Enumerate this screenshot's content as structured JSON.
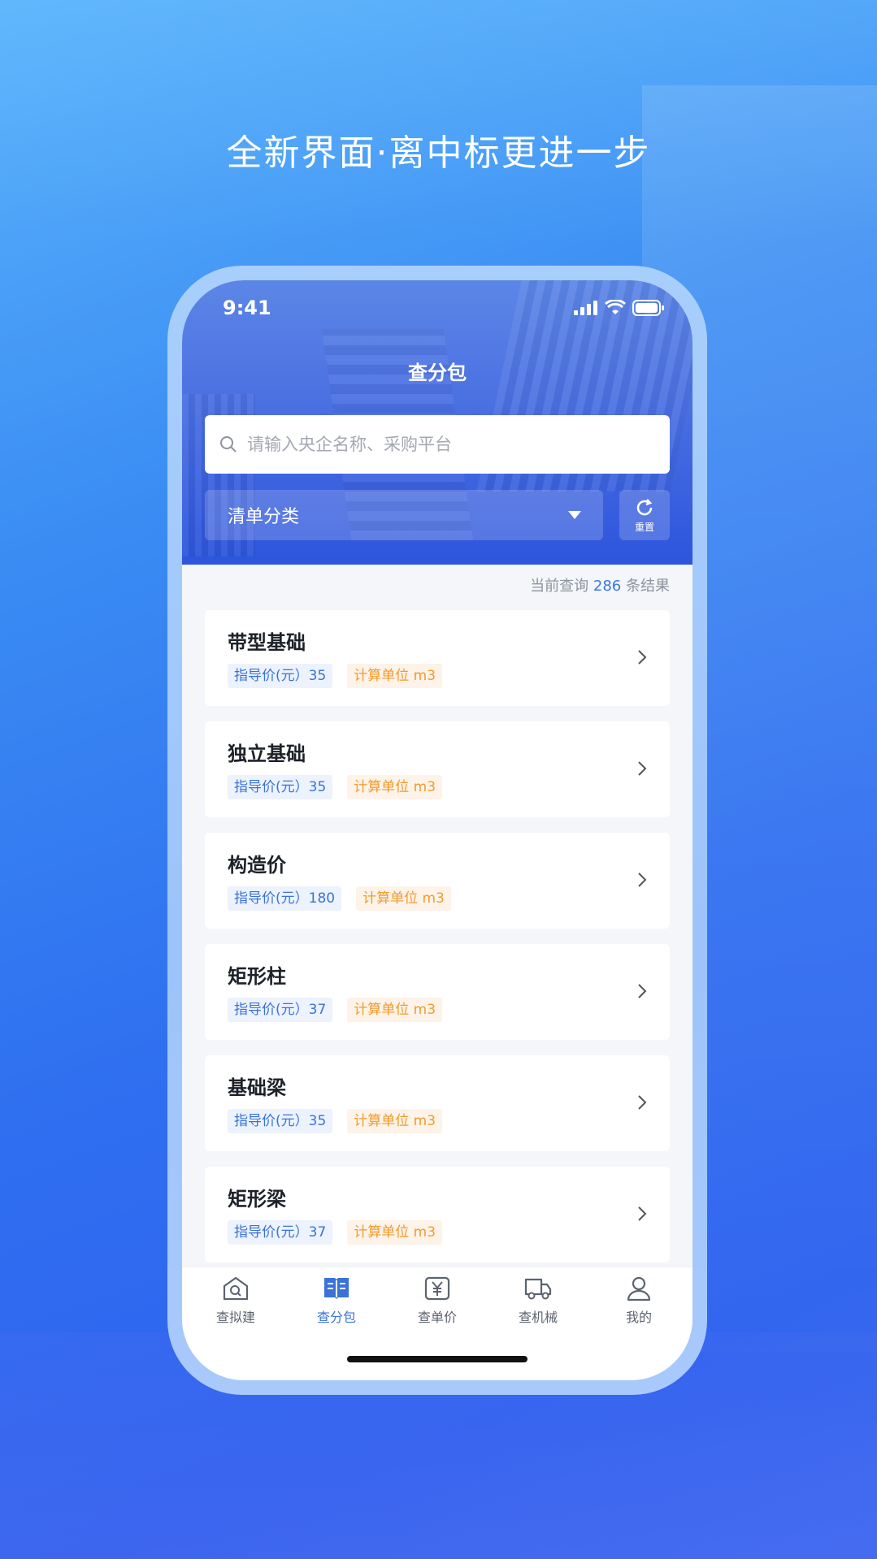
{
  "headline": "全新界面·离中标更进一步",
  "status_bar": {
    "time": "9:41"
  },
  "header": {
    "title": "查分包"
  },
  "search": {
    "placeholder": "请输入央企名称、采购平台"
  },
  "filter": {
    "category_label": "清单分类",
    "reset_label": "重置"
  },
  "results": {
    "prefix": "当前查询",
    "count": "286",
    "suffix": "条结果"
  },
  "items": [
    {
      "title": "带型基础",
      "price_tag": "指导价(元）35",
      "unit_tag": "计算单位  m3"
    },
    {
      "title": "独立基础",
      "price_tag": "指导价(元）35",
      "unit_tag": "计算单位  m3"
    },
    {
      "title": "构造价",
      "price_tag": "指导价(元）180",
      "unit_tag": "计算单位  m3"
    },
    {
      "title": "矩形柱",
      "price_tag": "指导价(元）37",
      "unit_tag": "计算单位  m3"
    },
    {
      "title": "基础梁",
      "price_tag": "指导价(元）35",
      "unit_tag": "计算单位  m3"
    },
    {
      "title": "矩形梁",
      "price_tag": "指导价(元）37",
      "unit_tag": "计算单位  m3"
    }
  ],
  "tabbar": [
    {
      "label": "查拟建",
      "icon": "home-search-icon",
      "active": false
    },
    {
      "label": "查分包",
      "icon": "book-icon",
      "active": true
    },
    {
      "label": "查单价",
      "icon": "yen-icon",
      "active": false
    },
    {
      "label": "查机械",
      "icon": "truck-icon",
      "active": false
    },
    {
      "label": "我的",
      "icon": "user-icon",
      "active": false
    }
  ],
  "colors": {
    "accent": "#3a72d8",
    "unit_tag": "#f29a2e",
    "hero": "#2d55dc"
  }
}
